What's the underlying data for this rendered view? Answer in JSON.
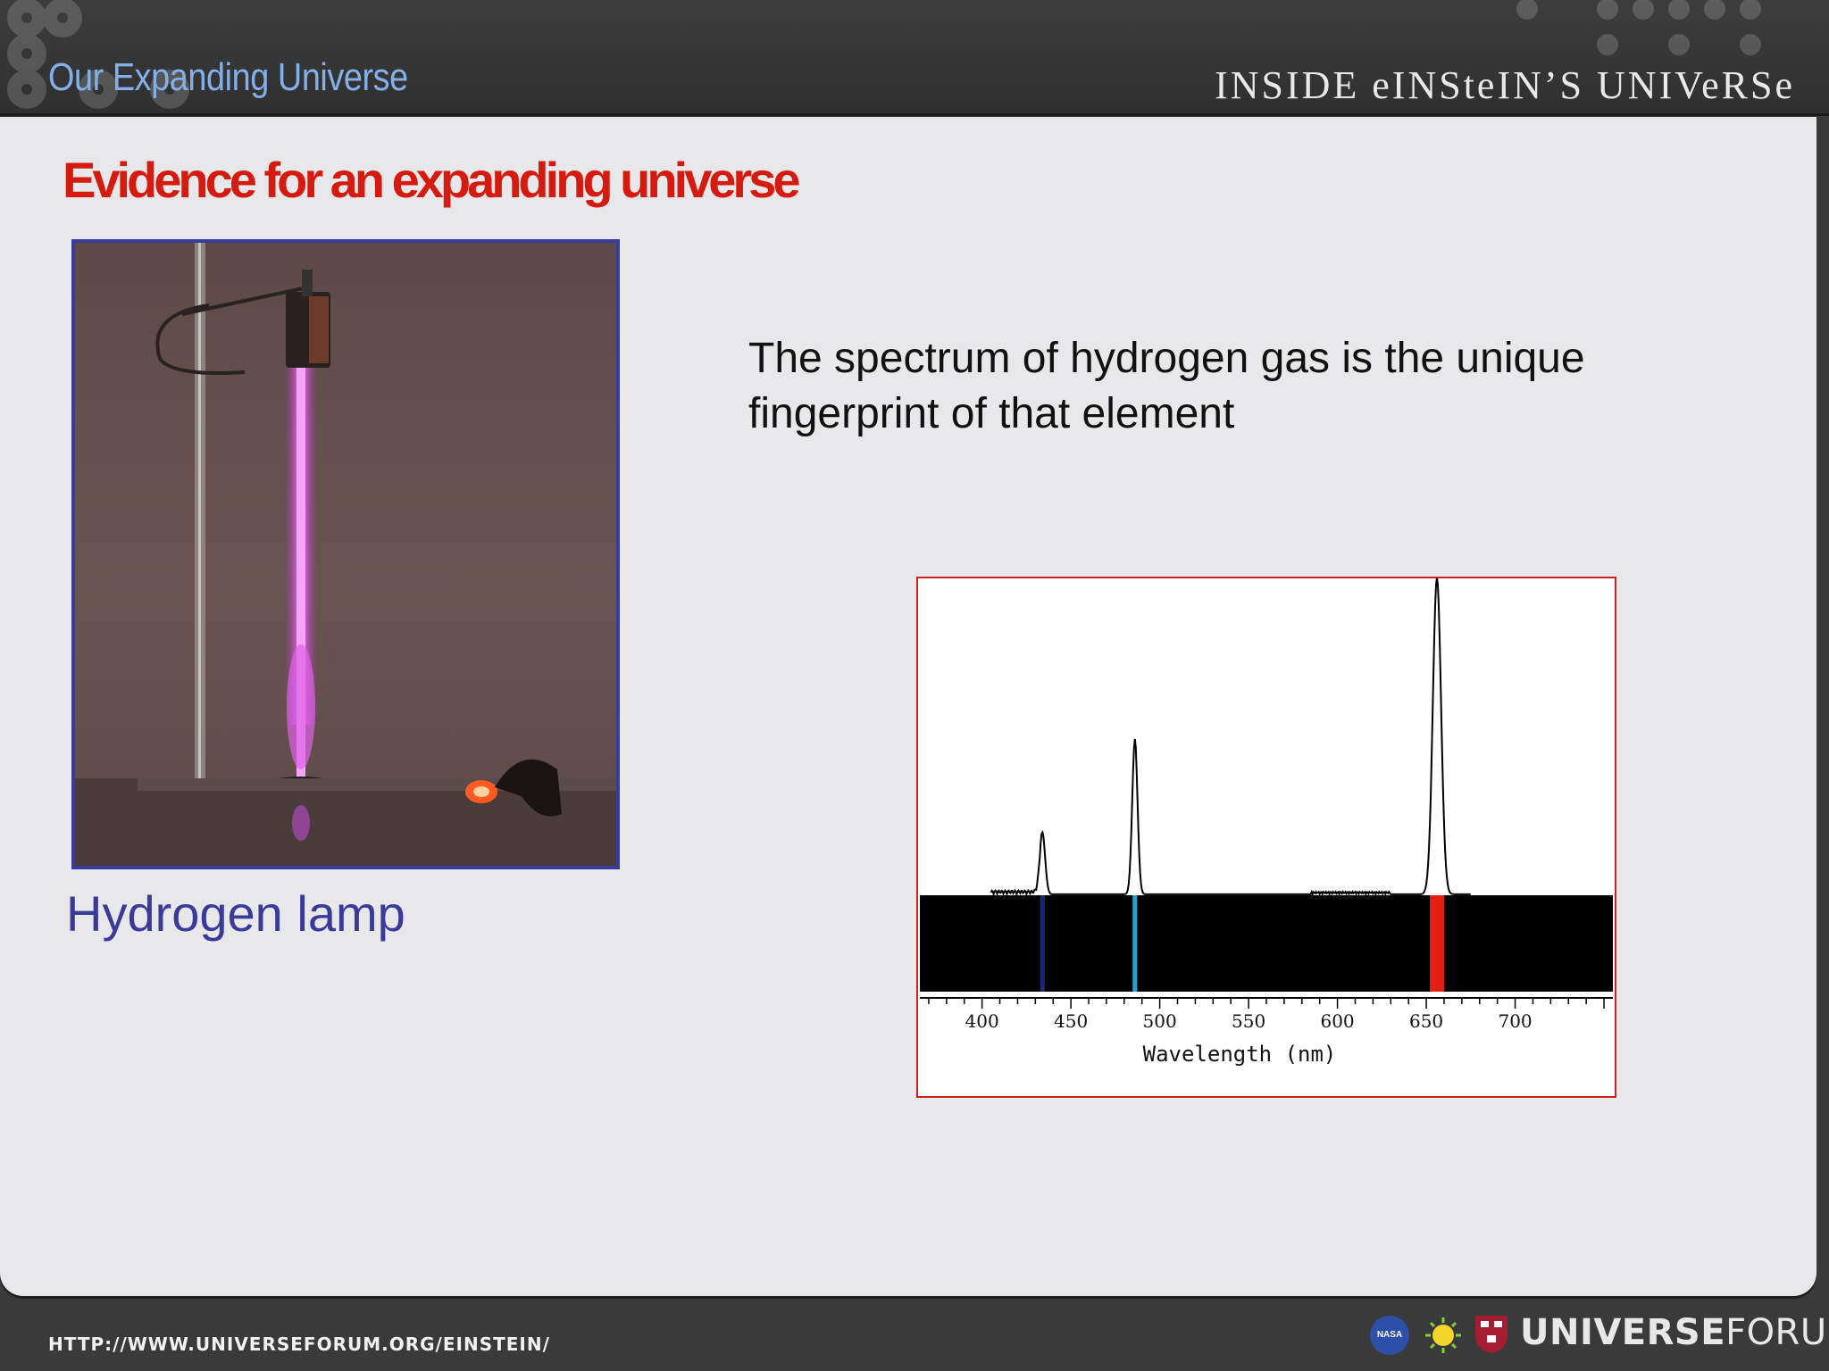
{
  "header": {
    "title": "Our Expanding Universe",
    "brand": "INSIDE eINSteIN’S UNIVeRSe"
  },
  "slide": {
    "title": "Evidence for an expanding universe",
    "photo_caption": "Hydrogen lamp",
    "description_lines": [
      "The spectrum of hydrogen gas is the unique",
      "fingerprint of that element"
    ]
  },
  "chart_data": {
    "type": "line",
    "title": "",
    "xlabel": "Wavelength (nm)",
    "ylabel": "",
    "xlim": [
      365,
      755
    ],
    "ticks": [
      "400",
      "450",
      "500",
      "550",
      "600",
      "650",
      "700"
    ],
    "tick_values": [
      400,
      450,
      500,
      550,
      600,
      650,
      700
    ],
    "peaks": [
      {
        "x": 434,
        "y": 0.19
      },
      {
        "x": 486,
        "y": 0.49
      },
      {
        "x": 656,
        "y": 1.0
      }
    ],
    "emission_lines": [
      {
        "x": 434,
        "color": "#1a2a7a"
      },
      {
        "x": 486,
        "color": "#2aa0d0"
      },
      {
        "x": 656,
        "color": "#e02010"
      }
    ],
    "grid": false
  },
  "footer": {
    "url": "HTTP://WWW.UNIVERSEFORUM.ORG/EINSTEIN/",
    "nasa_label": "NASA",
    "logo_bold": "UNIVERSE",
    "logo_light": "FORUM"
  },
  "colors": {
    "header_bg": "#333333",
    "title_red": "#d51a10",
    "caption_blue": "#3a3a9a",
    "header_blue": "#84b0ea"
  }
}
